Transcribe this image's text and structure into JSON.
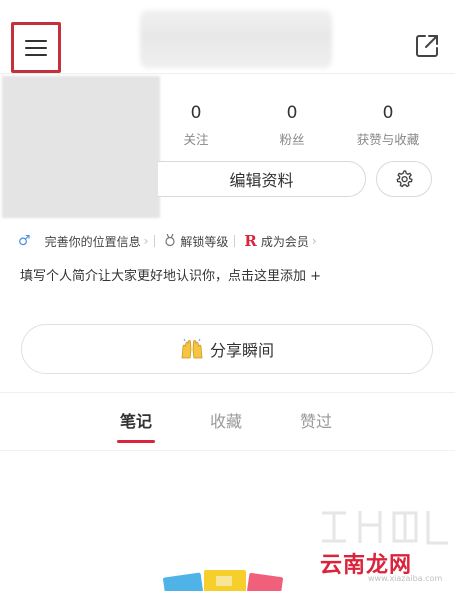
{
  "header": {
    "menu_icon": "hamburger-menu-icon",
    "share_icon": "external-share-icon",
    "highlight_color": "#c4313b"
  },
  "stats": [
    {
      "value": "0",
      "label": "关注"
    },
    {
      "value": "0",
      "label": "粉丝"
    },
    {
      "value": "0",
      "label": "获赞与收藏"
    }
  ],
  "profile": {
    "edit_label": "编辑资料",
    "settings_icon": "gear-icon"
  },
  "tags": {
    "gender_icon": "♂",
    "location": "完善你的位置信息",
    "level": "解锁等级",
    "vip_mark": "R",
    "vip": "成为会员"
  },
  "bio": {
    "prompt": "填写个人简介让大家更好地认识你，点击这里添加 +"
  },
  "share": {
    "label": "分享瞬间",
    "icon": "raised-hands-icon"
  },
  "tabs": [
    {
      "label": "笔记",
      "active": true
    },
    {
      "label": "收藏",
      "active": false
    },
    {
      "label": "赞过",
      "active": false
    }
  ],
  "accent_color": "#d9243c",
  "watermark": {
    "text": "云南龙网",
    "url": "www.xiazaiba.com"
  }
}
